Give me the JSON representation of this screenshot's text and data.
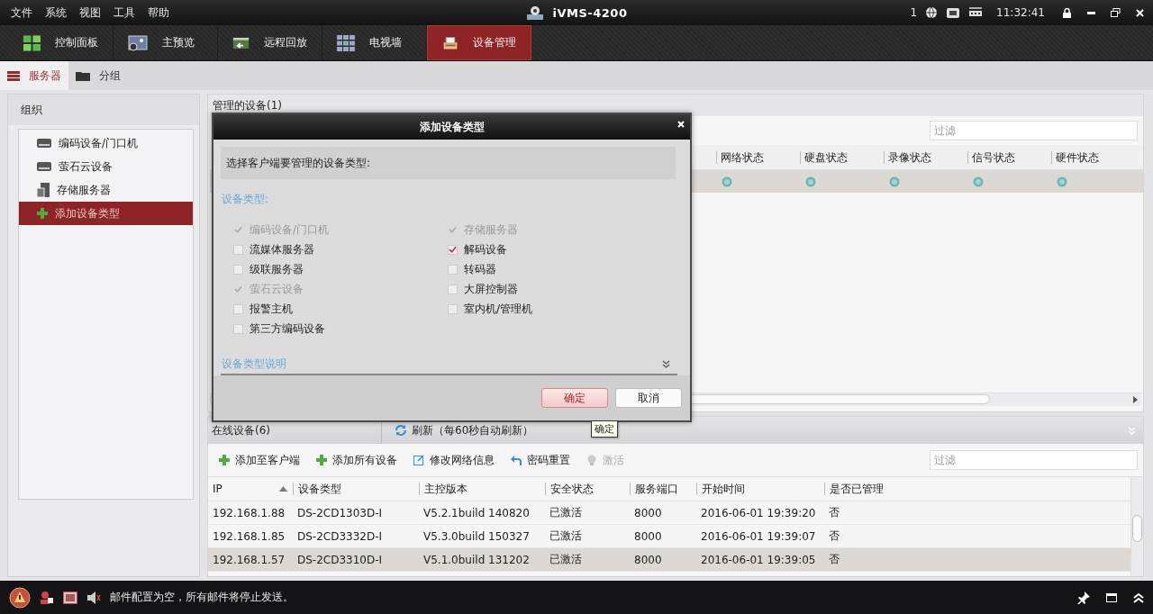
{
  "menu": [
    "文件",
    "系统",
    "视图",
    "工具",
    "帮助"
  ],
  "app_title": "iVMS-4200",
  "tray": {
    "count": "1",
    "time": "11:32:41"
  },
  "nav_tabs": [
    {
      "label": "控制面板",
      "selected": false
    },
    {
      "label": "主预览",
      "selected": false
    },
    {
      "label": "远程回放",
      "selected": false
    },
    {
      "label": "电视墙",
      "selected": false
    },
    {
      "label": "设备管理",
      "selected": true
    }
  ],
  "sub_tabs": [
    {
      "label": "服务器",
      "selected": true
    },
    {
      "label": "分组",
      "selected": false
    }
  ],
  "sidebar": {
    "title": "组织",
    "items": [
      {
        "label": "编码设备/门口机",
        "selected": false
      },
      {
        "label": "萤石云设备",
        "selected": false
      },
      {
        "label": "存储服务器",
        "selected": false
      },
      {
        "label": "添加设备类型",
        "selected": true
      }
    ]
  },
  "managed": {
    "title": "管理的设备(1)",
    "filter_placeholder": "过滤",
    "columns": [
      "网络状态",
      "硬盘状态",
      "录像状态",
      "信号状态",
      "硬件状态"
    ],
    "rows": [
      {
        "selected": true
      }
    ]
  },
  "online": {
    "title": "在线设备(6)",
    "refresh": "刷新（每60秒自动刷新）",
    "filter_placeholder": "过滤",
    "toolbar": [
      {
        "label": "添加至客户端",
        "kind": "add",
        "disabled": false
      },
      {
        "label": "添加所有设备",
        "kind": "add",
        "disabled": false
      },
      {
        "label": "修改网络信息",
        "kind": "edit",
        "disabled": false
      },
      {
        "label": "密码重置",
        "kind": "reset",
        "disabled": false
      },
      {
        "label": "激活",
        "kind": "activate",
        "disabled": true
      }
    ],
    "columns": [
      {
        "label": "IP",
        "sorted": true
      },
      {
        "label": "设备类型",
        "sorted": false
      },
      {
        "label": "主控版本",
        "sorted": false
      },
      {
        "label": "安全状态",
        "sorted": false
      },
      {
        "label": "服务端口",
        "sorted": false
      },
      {
        "label": "开始时间",
        "sorted": false
      },
      {
        "label": "是否已管理",
        "sorted": false
      }
    ],
    "rows": [
      {
        "cells": [
          "192.168.1.88",
          "DS-2CD1303D-I",
          "V5.2.1build 140820",
          "已激活",
          "8000",
          "2016-06-01 19:39:20",
          "否"
        ],
        "selected": false
      },
      {
        "cells": [
          "192.168.1.85",
          "DS-2CD3332D-I",
          "V5.3.0build 150327",
          "已激活",
          "8000",
          "2016-06-01 19:39:07",
          "否"
        ],
        "selected": false
      },
      {
        "cells": [
          "192.168.1.57",
          "DS-2CD3310D-I",
          "V5.1.0build 131202",
          "已激活",
          "8000",
          "2016-06-01 19:39:05",
          "否"
        ],
        "selected": true
      }
    ]
  },
  "dialog": {
    "title": "添加设备类型",
    "prompt": "选择客户端要管理的设备类型:",
    "section": "设备类型:",
    "columns": [
      [
        {
          "label": "编码设备/门口机",
          "checked": true,
          "disabled": true
        },
        {
          "label": "流媒体服务器",
          "checked": false,
          "disabled": false
        },
        {
          "label": "级联服务器",
          "checked": false,
          "disabled": false
        },
        {
          "label": "萤石云设备",
          "checked": true,
          "disabled": true
        },
        {
          "label": "报警主机",
          "checked": false,
          "disabled": false
        },
        {
          "label": "第三方编码设备",
          "checked": false,
          "disabled": false
        }
      ],
      [
        {
          "label": "存储服务器",
          "checked": true,
          "disabled": true
        },
        {
          "label": "解码设备",
          "checked": true,
          "disabled": false
        },
        {
          "label": "转码器",
          "checked": false,
          "disabled": false
        },
        {
          "label": "大屏控制器",
          "checked": false,
          "disabled": false
        },
        {
          "label": "室内机/管理机",
          "checked": false,
          "disabled": false
        }
      ]
    ],
    "link": "设备类型说明",
    "buttons": [
      {
        "label": "确定",
        "kind": "primary"
      },
      {
        "label": "取消",
        "kind": "secondary"
      }
    ],
    "tooltip": "确定"
  },
  "status_bar": {
    "message": "邮件配置为空，所有邮件将停止发送。"
  }
}
